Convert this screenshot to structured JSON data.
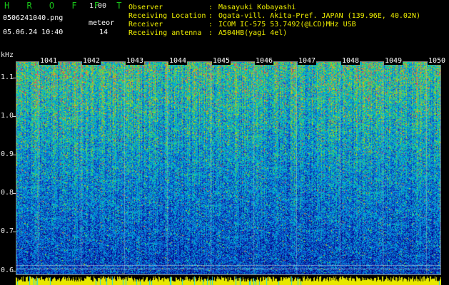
{
  "header": {
    "app_logo": "H R O F F T",
    "version": "1.00",
    "file_name": "0506241040.png",
    "mode_label": "meteor",
    "datetime": "05.06.24 10:40",
    "meteor_count": "14",
    "fields": [
      {
        "label": "Observer",
        "sep": ":",
        "value": "Masayuki Kobayashi"
      },
      {
        "label": "Receiving Location",
        "sep": ":",
        "value": "Ogata-vill. Akita-Pref. JAPAN (139.96E, 40.02N)"
      },
      {
        "label": "Receiver",
        "sep": ":",
        "value": "ICOM IC-575 53.7492(@LCD)MHz USB"
      },
      {
        "label": "Receiving antenna",
        "sep": ":",
        "value": "A504HB(yagi 4el)"
      }
    ]
  },
  "axis": {
    "unit": "kHz",
    "freq_ticks": [
      "1.1",
      "1.0",
      "0.9",
      "0.8",
      "0.7",
      "0.6"
    ],
    "freq_range": [
      0.59,
      1.14
    ],
    "minute_labels": [
      "1041",
      "1042",
      "1043",
      "1044",
      "1045",
      "1046",
      "1047",
      "1048",
      "1049",
      "1050"
    ]
  },
  "colors": {
    "logo_green": "#19c419",
    "heading_yellow": "#f0f000",
    "baseline_yellow": "#e8e800",
    "baseline_cyan": "#22d8e8"
  }
}
